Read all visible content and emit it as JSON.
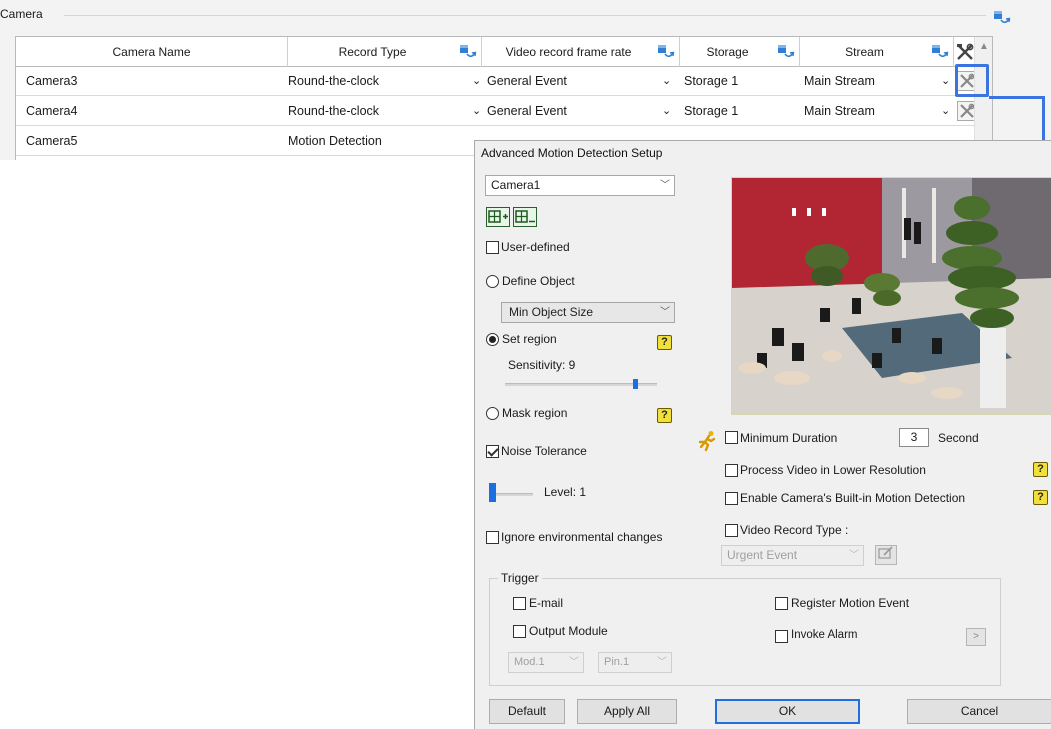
{
  "camera_panel": {
    "title": "Camera",
    "columns": [
      "Camera Name",
      "Record Type",
      "Video record frame rate",
      "Storage",
      "Stream"
    ],
    "rows": [
      {
        "name": "Camera3",
        "record_type": "Round-the-clock",
        "frame_rate": "General Event",
        "storage": "Storage 1",
        "stream": "Main Stream"
      },
      {
        "name": "Camera4",
        "record_type": "Round-the-clock",
        "frame_rate": "General Event",
        "storage": "Storage 1",
        "stream": "Main Stream"
      },
      {
        "name": "Camera5",
        "record_type": "Motion Detection",
        "frame_rate": "",
        "storage": "",
        "stream": ""
      }
    ],
    "dropdown_glyph": "⌄"
  },
  "dialog": {
    "title": "Advanced Motion Detection Setup",
    "camera_select": "Camera1",
    "user_defined_label": "User-defined",
    "define_object_label": "Define Object",
    "min_object_select": "Min Object Size",
    "set_region_label": "Set region",
    "sensitivity_label": "Sensitivity: 9",
    "sensitivity_value": 9,
    "mask_region_label": "Mask region",
    "noise_tolerance_label": "Noise Tolerance",
    "noise_level_label": "Level: 1",
    "ignore_env_label": "Ignore environmental changes",
    "min_duration_label": "Minimum Duration",
    "min_duration_value": "3",
    "min_duration_unit": "Second",
    "process_lower_res_label": "Process Video in Lower Resolution",
    "builtin_motion_label": "Enable Camera's Built-in Motion Detection",
    "video_record_type_label": "Video Record Type :",
    "video_record_type_select": "Urgent Event",
    "help_glyph": "?",
    "trigger": {
      "legend": "Trigger",
      "email_label": "E-mail",
      "output_module_label": "Output Module",
      "module_select": "Mod.1",
      "pin_select": "Pin.1",
      "register_motion_label": "Register Motion Event",
      "invoke_alarm_label": "Invoke Alarm",
      "invoke_alarm_btn": ">"
    },
    "buttons": {
      "default": "Default",
      "apply_all": "Apply All",
      "ok": "OK",
      "cancel": "Cancel"
    }
  },
  "colors": {
    "accent_blue": "#3b73e0",
    "help_yellow": "#f2e03a",
    "slider_blue": "#1b6fe0"
  }
}
